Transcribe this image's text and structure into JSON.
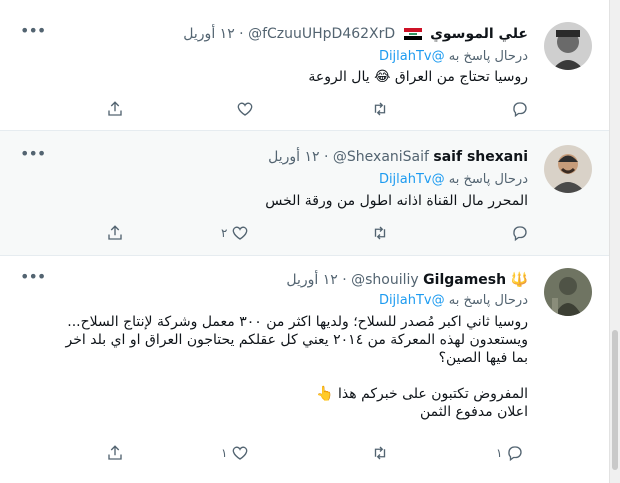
{
  "tweets": [
    {
      "name": "علي الموسوي",
      "handle": "@fCzuuUHpD462XrD",
      "date": "١٢ أوريل",
      "sep": "·",
      "reply_prefix": "درحال پاسخ به",
      "reply_to": "@DijlahTv",
      "text": "روسيا تحتاج من العراق 😂 يال الروعة",
      "likes": "",
      "has_flag": true
    },
    {
      "name": "saif shexani",
      "handle": "@ShexaniSaif",
      "date": "١٢ أوريل",
      "sep": "·",
      "reply_prefix": "درحال پاسخ به",
      "reply_to": "@DijlahTv",
      "text": "المحرر مال القناة اذانه اطول من ورقة الخس",
      "likes": "٢"
    },
    {
      "name": "Gilgamesh",
      "name_emoji": "🔱",
      "handle": "@shouiliy",
      "date": "١٢ أوريل",
      "sep": "·",
      "reply_prefix": "درحال پاسخ به",
      "reply_to": "@DijlahTv",
      "text": "روسيا ثاني اكبر مُصدر للسلاح؛ ولديها اكثر من ٣٠٠ معمل وشركة لإنتاج السلاح...\nويستعدون لهذه المعركة من ٢٠١٤ يعني كل عقلكم يحتاجون العراق او اي بلد اخر\nبما فيها الصين؟\n\nالمفروض تكتبون على خبركم هذا 👆\nاعلان مدفوع الثمن",
      "likes": "١",
      "replies": "١"
    }
  ],
  "icons": {
    "more": "more-dots-icon",
    "reply": "reply-bubble-icon",
    "retweet": "retweet-icon",
    "like": "heart-icon",
    "share": "share-upload-icon"
  },
  "colors": {
    "link": "#1d9bf0",
    "muted": "#536471",
    "highlight_bg": "#f7f9f9"
  }
}
